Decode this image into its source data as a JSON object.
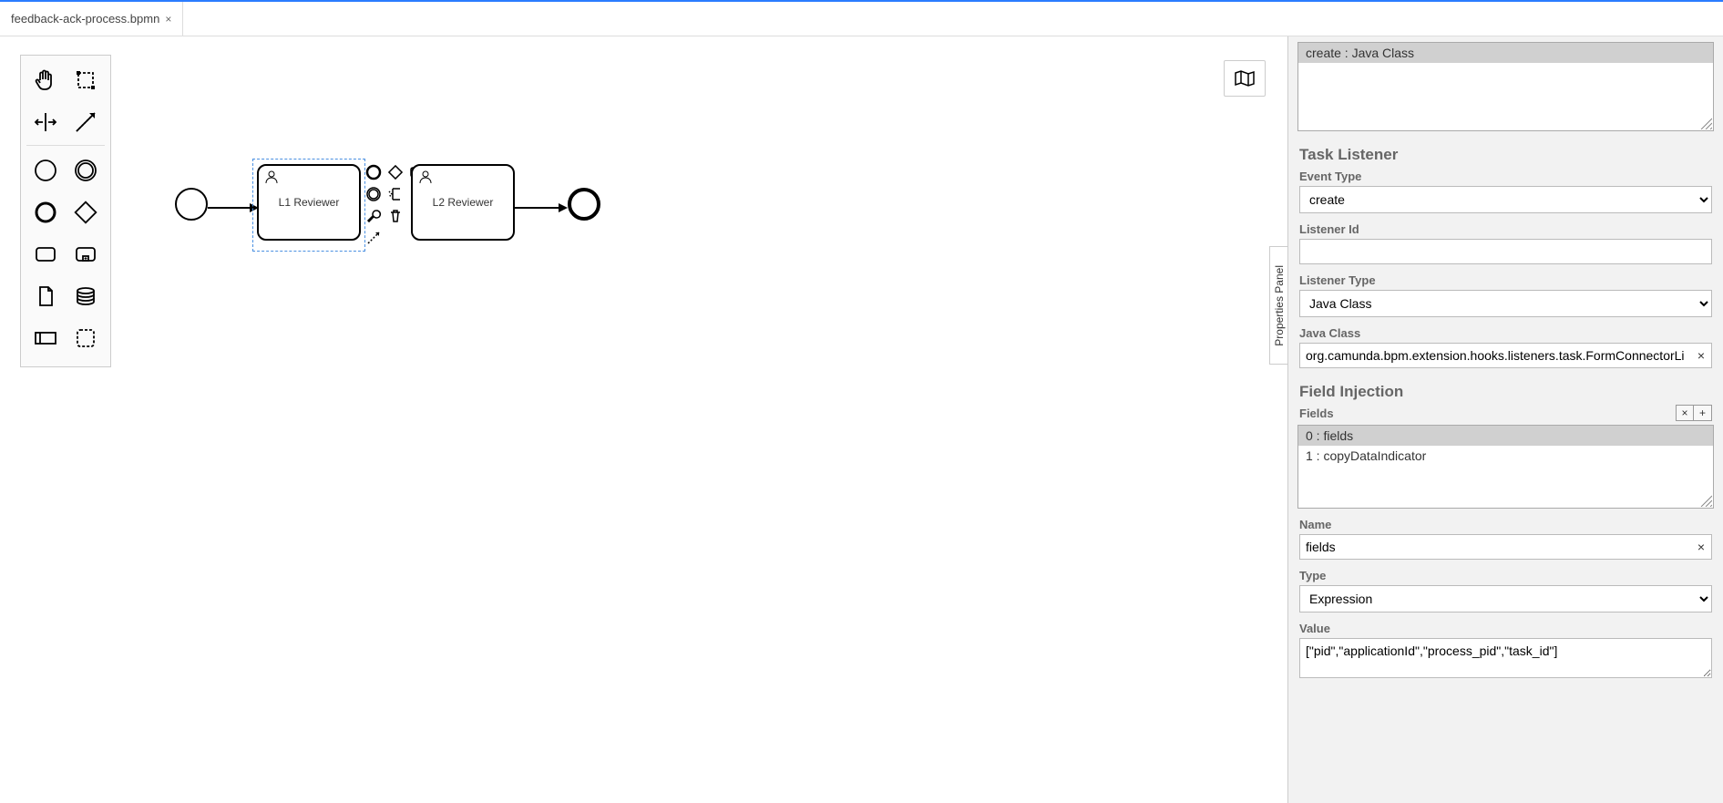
{
  "tab": {
    "filename": "feedback-ack-process.bpmn"
  },
  "canvas": {
    "task1_label": "L1 Reviewer",
    "task2_label": "L2 Reviewer"
  },
  "panel": {
    "toggle_label": "Properties Panel",
    "listener_list": {
      "row0": "create : Java Class"
    },
    "task_listener_title": "Task Listener",
    "event_type_label": "Event Type",
    "event_type_value": "create",
    "listener_id_label": "Listener Id",
    "listener_id_value": "",
    "listener_type_label": "Listener Type",
    "listener_type_value": "Java Class",
    "java_class_label": "Java Class",
    "java_class_value": "org.camunda.bpm.extension.hooks.listeners.task.FormConnectorLi",
    "field_injection_title": "Field Injection",
    "fields_label": "Fields",
    "fields_list": {
      "row0": "0 : fields",
      "row1": "1 : copyDataIndicator"
    },
    "name_label": "Name",
    "name_value": "fields",
    "type_label": "Type",
    "type_value": "Expression",
    "value_label": "Value",
    "value_value": "[\"pid\",\"applicationId\",\"process_pid\",\"task_id\"]"
  }
}
